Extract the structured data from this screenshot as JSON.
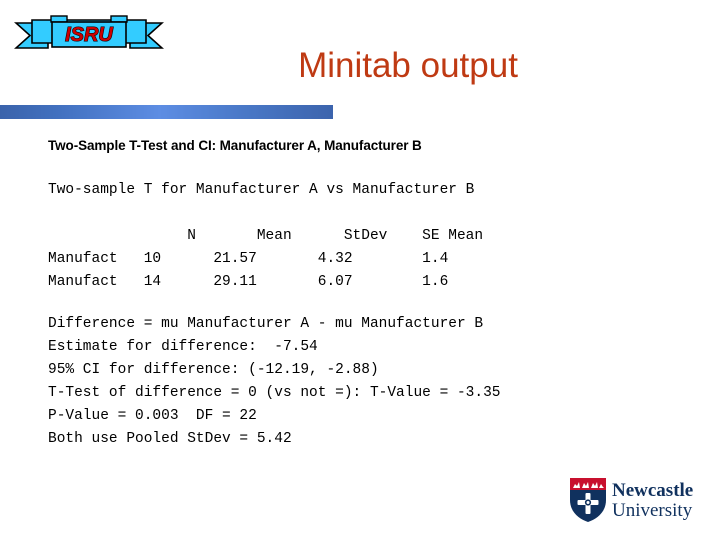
{
  "slide": {
    "title": "Minitab output",
    "title_color": "#bf3a13",
    "rule_color": "#4271c0",
    "background": "#ffffff"
  },
  "isru_logo": {
    "text": "ISRU",
    "ribbon_color": "#33ccff",
    "text_color": "#cc0000",
    "outline_color": "#000000"
  },
  "output": {
    "heading": "Two-Sample T-Test and CI: Manufacturer A, Manufacturer B",
    "subheading": "Two-sample T for Manufacturer A vs Manufacturer B",
    "table": {
      "header_line": "                N       Mean      StDev    SE Mean",
      "columns": [
        "",
        "N",
        "Mean",
        "StDev",
        "SE Mean"
      ],
      "rows": [
        {
          "line": "Manufact   10      21.57       4.32        1.4",
          "label": "Manufact",
          "n": "10",
          "mean": "21.57",
          "stdev": "4.32",
          "se_mean": "1.4"
        },
        {
          "line": "Manufact   14      29.11       6.07        1.6",
          "label": "Manufact",
          "n": "14",
          "mean": "29.11",
          "stdev": "6.07",
          "se_mean": "1.6"
        }
      ]
    },
    "lines": {
      "difference": "Difference = mu Manufacturer A - mu Manufacturer B",
      "estimate": "Estimate for difference:  -7.54",
      "confidence_interval": "95% CI for difference: (-12.19, -2.88)",
      "t_test": "T-Test of difference = 0 (vs not =): T-Value = -3.35",
      "p_value": "P-Value = 0.003  DF = 22",
      "pooled_stdev": "Both use Pooled StDev = 5.42"
    }
  },
  "results": {
    "test_name": "Two-Sample T-Test and CI",
    "sample_a_label": "Manufact",
    "sample_a_n": 10,
    "sample_a_mean": 21.57,
    "sample_a_stdev": 4.32,
    "sample_a_se_mean": 1.4,
    "sample_b_label": "Manufact",
    "sample_b_n": 14,
    "sample_b_mean": 29.11,
    "sample_b_stdev": 6.07,
    "sample_b_se_mean": 1.6,
    "estimate_difference": -7.54,
    "ci_level": "95%",
    "ci_lower": -12.19,
    "ci_upper": -2.88,
    "t_value": -3.35,
    "p_value": 0.003,
    "df": 22,
    "pooled_stdev": 5.42
  },
  "university_logo": {
    "line1": "Newcastle",
    "line2": "University",
    "navy": "#10315e",
    "red": "#c8102e"
  }
}
